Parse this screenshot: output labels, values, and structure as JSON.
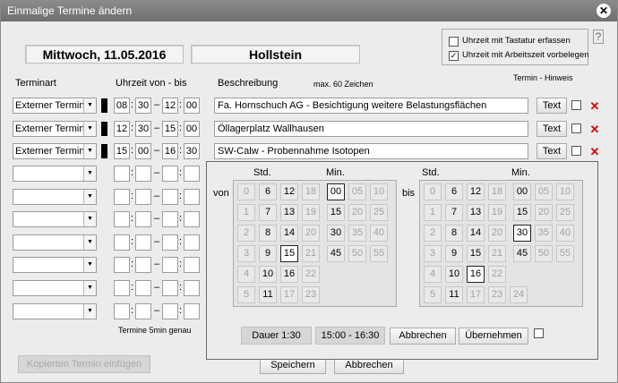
{
  "window": {
    "title": "Einmalige Termine ändern"
  },
  "header": {
    "date": "Mittwoch, 11.05.2016",
    "place": "Hollstein"
  },
  "options": [
    {
      "label": "Uhrzeit mit Tastatur erfassen",
      "checked": false
    },
    {
      "label": "Uhrzeit mit Arbeitszeit vorbelegen",
      "checked": true
    }
  ],
  "help": "?",
  "columns": {
    "terminart": "Terminart",
    "uhrzeit": "Uhrzeit von - bis",
    "beschreibung": "Beschreibung",
    "max": "max. 60 Zeichen",
    "hinweis": "Termin - Hinweis"
  },
  "rows": [
    {
      "type": "Externer Termin",
      "h1": "08",
      "m1": "30",
      "h2": "12",
      "m2": "00",
      "desc": "Fa. Hornschuch AG - Besichtigung weitere Belastungsflächen",
      "text": "Text"
    },
    {
      "type": "Externer Termin",
      "h1": "12",
      "m1": "30",
      "h2": "15",
      "m2": "00",
      "desc": "Öllagerplatz Wallhausen",
      "text": "Text"
    },
    {
      "type": "Externer Termin",
      "h1": "15",
      "m1": "00",
      "h2": "16",
      "m2": "30",
      "desc": "SW-Calw - Probennahme Isotopen",
      "text": "Text"
    }
  ],
  "footer_note": "Termine 5min genau",
  "buttons": {
    "paste": "Kopierten Termin einfügen",
    "save": "Speichern",
    "cancel": "Abbrechen"
  },
  "picker": {
    "std_label": "Std.",
    "min_label": "Min.",
    "von": "von",
    "bis": "bis",
    "von_hours": [
      [
        "0",
        "6",
        "12",
        "18"
      ],
      [
        "1",
        "7",
        "13",
        "19"
      ],
      [
        "2",
        "8",
        "14",
        "20"
      ],
      [
        "3",
        "9",
        "15",
        "21"
      ],
      [
        "4",
        "10",
        "16",
        "22"
      ],
      [
        "5",
        "11",
        "17",
        "23"
      ]
    ],
    "bis_hours": [
      [
        "0",
        "6",
        "12",
        "18"
      ],
      [
        "1",
        "7",
        "13",
        "19"
      ],
      [
        "2",
        "8",
        "14",
        "20"
      ],
      [
        "3",
        "9",
        "15",
        "21"
      ],
      [
        "4",
        "10",
        "16",
        "22"
      ],
      [
        "5",
        "11",
        "17",
        "23",
        "24"
      ]
    ],
    "minutes": [
      [
        "00",
        "05",
        "10"
      ],
      [
        "15",
        "20",
        "25"
      ],
      [
        "30",
        "35",
        "40"
      ],
      [
        "45",
        "50",
        "55"
      ]
    ],
    "dauer": "Dauer  1:30",
    "range": "15:00 - 16:30",
    "abbrechen": "Abbrechen",
    "uebernehmen": "Übernehmen"
  }
}
